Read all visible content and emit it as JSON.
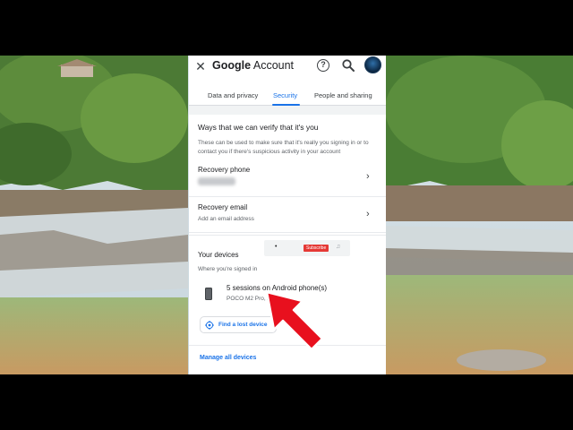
{
  "header": {
    "close_icon": "close-icon",
    "brand_google": "Google",
    "brand_account": "Account",
    "help_symbol": "?",
    "search_icon": "search-icon",
    "avatar_icon": "avatar"
  },
  "tabs": [
    {
      "label": "Data and privacy",
      "active": false
    },
    {
      "label": "Security",
      "active": true
    },
    {
      "label": "People and sharing",
      "active": false
    }
  ],
  "verify": {
    "title": "Ways that we can verify that it's you",
    "description": "These can be used to make sure that it's really you signing in or to contact you if there's suspicious activity in your account",
    "recovery_phone": {
      "label": "Recovery phone"
    },
    "recovery_email": {
      "label": "Recovery email",
      "sub": "Add an email address"
    }
  },
  "devices": {
    "title": "Your devices",
    "signed_in_label": "Where you're signed in",
    "session_title": "5 sessions on Android phone(s)",
    "session_sub": "POCO M2 Pro, Android, ...",
    "find_button": "Find a lost device",
    "manage_link": "Manage all devices"
  },
  "overlay": {
    "subscribe_label": "Subscribe",
    "dot": "•"
  },
  "colors": {
    "accent": "#1a73e8",
    "text_primary": "#202124",
    "text_secondary": "#5f6368",
    "subscribe_red": "#e53935",
    "arrow_red": "#e8101e"
  }
}
